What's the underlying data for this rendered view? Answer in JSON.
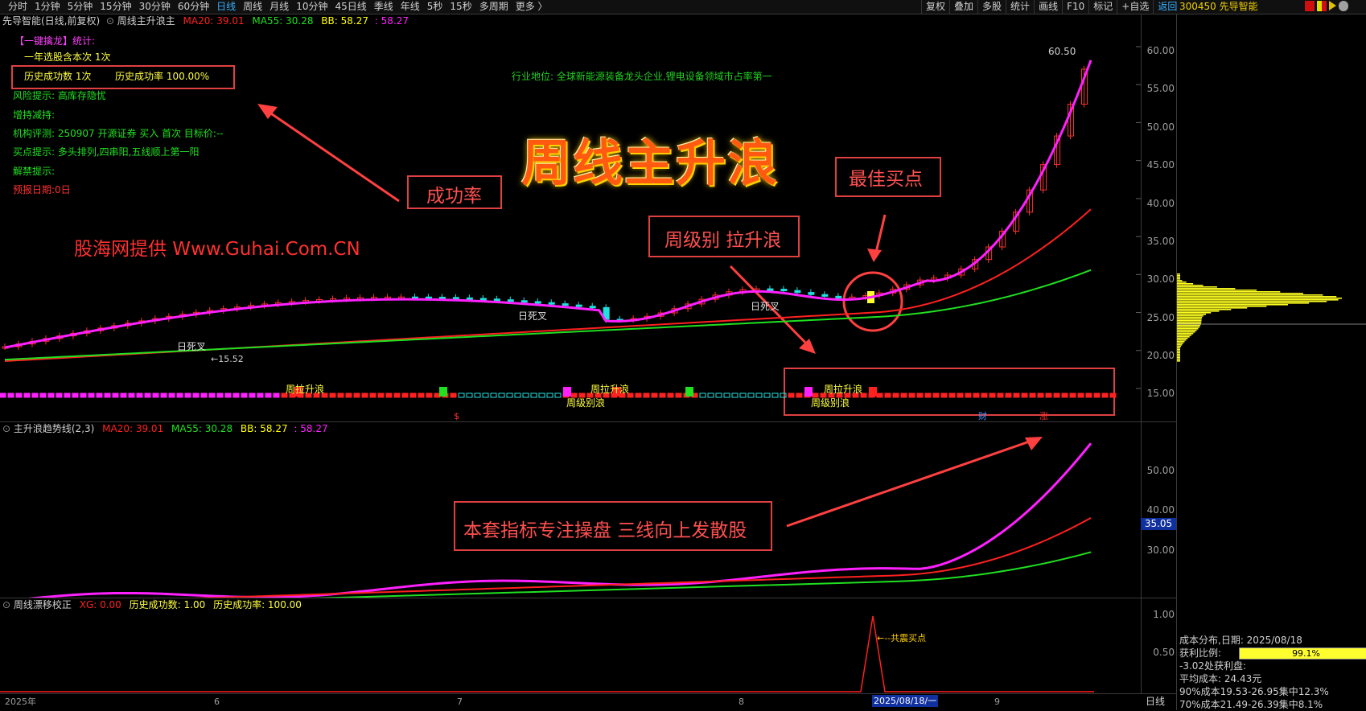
{
  "toolbar": {
    "periods": [
      "分时",
      "1分钟",
      "5分钟",
      "15分钟",
      "30分钟",
      "60分钟",
      "日线",
      "周线",
      "月线",
      "10分钟",
      "45日线",
      "季线",
      "年线",
      "5秒",
      "15秒",
      "多周期",
      "更多 〉"
    ],
    "active_period": "日线",
    "right_tools": [
      "复权",
      "叠加",
      "多股",
      "统计",
      "画线",
      "F10",
      "标记",
      "+自选",
      "返回"
    ],
    "stock_code": "300450 先导智能"
  },
  "main_panel": {
    "title": "先导智能(日线,前复权)",
    "indicator": "周线主升浪主",
    "ma20_label": "MA20: 39.01",
    "ma55_label": "MA55: 30.28",
    "bb_label": "BB: 58.27",
    "bb2_label": ": 58.27",
    "stats": {
      "title": "【一键擒龙】统计:",
      "selected": "一年选股含本次 1次",
      "success_count": "历史成功数 1次",
      "success_rate": "历史成功率 100.00%",
      "risk": "风险提示: 高库存隐忧",
      "holding": "增持减持:",
      "rating": "机构评测: 250907 开源证券 买入 首次 目标价:--",
      "buy_hint": "买点提示: 多头排列,四串阳,五线顺上第一阳",
      "unlock": "解禁提示:",
      "forecast": "预报日期:0日"
    },
    "industry": "行业地位: 全球新能源装备龙头企业,锂电设备领域市占率第一",
    "big_title": "周线主升浪",
    "watermark": "股海网提供 Www.Guhai.Com.CN",
    "ann_success": "成功率",
    "ann_best_buy": "最佳买点",
    "ann_weekly": "周级别 拉升浪",
    "price_high": "60.50",
    "price_low": "15.52",
    "dead_cross": [
      "日死叉",
      "日死叉",
      "日死叉"
    ],
    "wave_labels": [
      "周拉升浪",
      "周级别浪",
      "周拉升浪",
      "周拉升浪",
      "周级别浪"
    ],
    "markers": [
      "$",
      "财",
      "涨"
    ],
    "y_ticks": [
      "60.00",
      "55.00",
      "50.00",
      "45.00",
      "40.00",
      "35.00",
      "30.00",
      "25.00",
      "20.00",
      "15.00"
    ]
  },
  "mid_panel": {
    "title": "主升浪趋势线(2,3)",
    "ma20_label": "MA20: 39.01",
    "ma55_label": "MA55: 30.28",
    "bb_label": "BB: 58.27",
    "bb2_label": ": 58.27",
    "ann": "本套指标专注操盘 三线向上发散股",
    "current_value": "35.05",
    "y_ticks": [
      "50.00",
      "40.00",
      "30.00"
    ]
  },
  "bottom_panel": {
    "title": "周线漂移校正",
    "xg_label": "XG: 0.00",
    "count_label": "历史成功数: 1.00",
    "rate_label": "历史成功率: 100.00",
    "signal": "←--共震买点",
    "y_ticks": [
      "1.00",
      "0.50"
    ]
  },
  "x_axis": {
    "labels": [
      "2025年",
      "6",
      "7",
      "8",
      "9"
    ],
    "cursor_date": "2025/08/18/一",
    "period": "日线"
  },
  "cost_panel": {
    "date_line": "成本分布,日期: 2025/08/18",
    "profit_label": "获利比例:",
    "profit_value": "99.1%",
    "profit_fill": 0.991,
    "profit_line": "-3.02处获利盘:",
    "avg_cost": "平均成本: 24.43元",
    "cost90": "90%成本19.53-26.95集中12.3%",
    "cost70": "70%成本21.49-26.39集中8.1%"
  },
  "colors": {
    "ma20": "#ff2020",
    "ma55": "#20e020",
    "bb": "#ff20ff",
    "accent": "#38b0ff",
    "annotation": "#e04040"
  }
}
